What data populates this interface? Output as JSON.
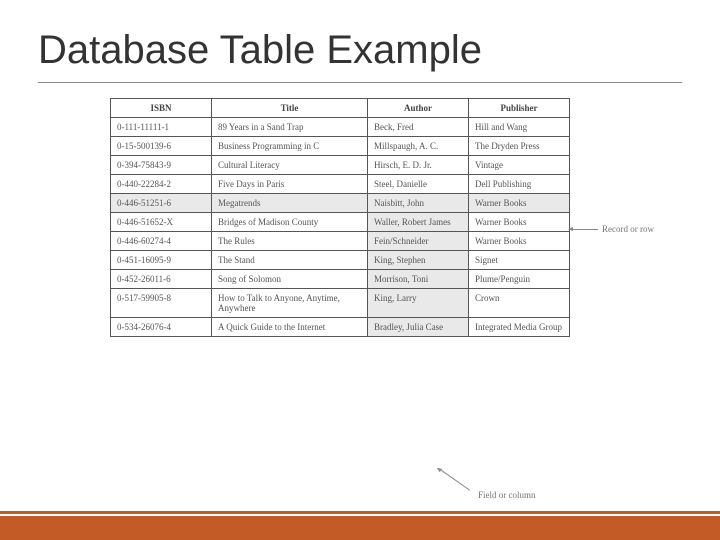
{
  "title": "Database Table Example",
  "headers": [
    "ISBN",
    "Title",
    "Author",
    "Publisher"
  ],
  "rows": [
    {
      "isbn": "0-111-11111-1",
      "title": "89 Years in a Sand Trap",
      "author": "Beck, Fred",
      "publisher": "Hill and Wang"
    },
    {
      "isbn": "0-15-500139-6",
      "title": "Business Programming in C",
      "author": "Millspaugh, A. C.",
      "publisher": "The Dryden Press"
    },
    {
      "isbn": "0-394-75843-9",
      "title": "Cultural Literacy",
      "author": "Hirsch, E. D. Jr.",
      "publisher": "Vintage"
    },
    {
      "isbn": "0-440-22284-2",
      "title": "Five Days in Paris",
      "author": "Steel, Danielle",
      "publisher": "Dell Publishing"
    },
    {
      "isbn": "0-446-51251-6",
      "title": "Megatrends",
      "author": "Naisbitt, John",
      "publisher": "Warner Books"
    },
    {
      "isbn": "0-446-51652-X",
      "title": "Bridges of Madison County",
      "author": "Waller, Robert James",
      "publisher": "Warner Books"
    },
    {
      "isbn": "0-446-60274-4",
      "title": "The Rules",
      "author": "Fein/Schneider",
      "publisher": "Warner Books"
    },
    {
      "isbn": "0-451-16095-9",
      "title": "The Stand",
      "author": "King, Stephen",
      "publisher": "Signet"
    },
    {
      "isbn": "0-452-26011-6",
      "title": "Song of Solomon",
      "author": "Morrison, Toni",
      "publisher": "Plume/Penguin"
    },
    {
      "isbn": "0-517-59905-8",
      "title": "How to Talk to Anyone, Anytime, Anywhere",
      "author": "King, Larry",
      "publisher": "Crown"
    },
    {
      "isbn": "0-534-26076-4",
      "title": "A Quick Guide to the Internet",
      "author": "Bradley, Julia Case",
      "publisher": "Integrated Media Group"
    }
  ],
  "callouts": {
    "row": "Record or row",
    "field": "Field or column"
  }
}
